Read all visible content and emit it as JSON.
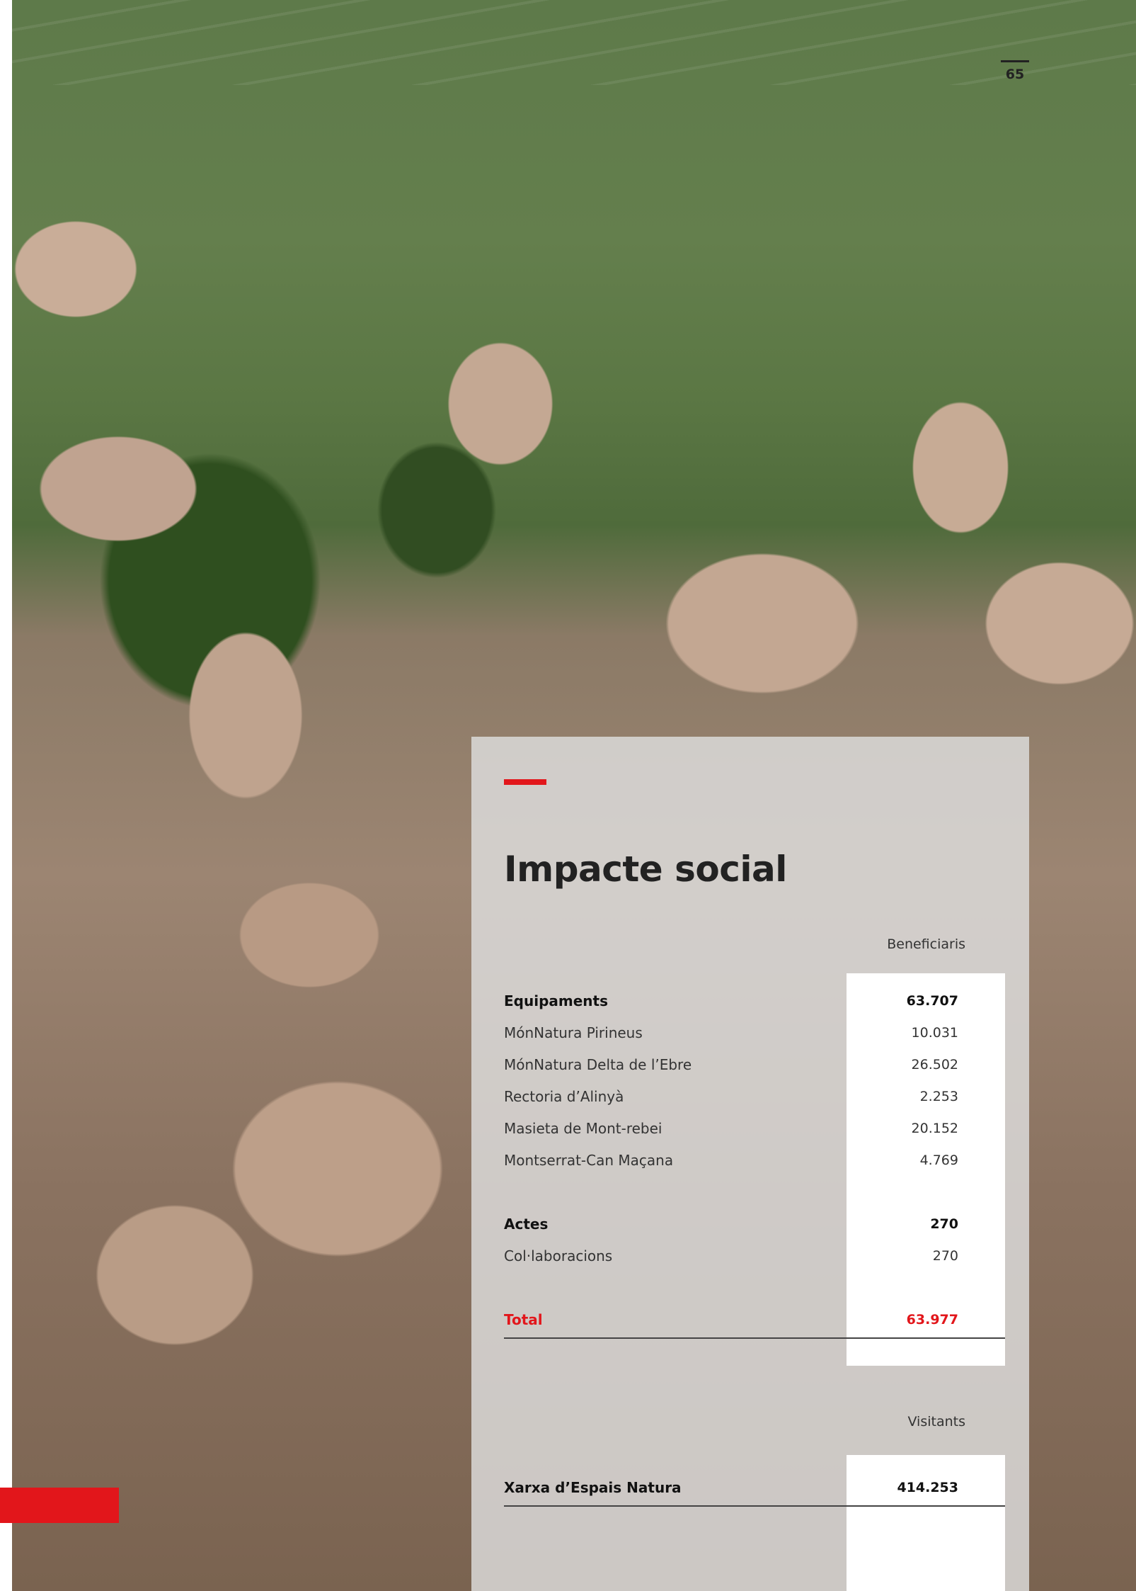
{
  "page": {
    "number": "65"
  },
  "panel": {
    "title": "Impacte social",
    "beneficiaris": {
      "column_header": "Beneficiaris",
      "sections": [
        {
          "label": "Equipaments",
          "value": "63.707",
          "items": [
            {
              "label": "MónNatura Pirineus",
              "value": "10.031"
            },
            {
              "label": "MónNatura Delta de l’Ebre",
              "value": "26.502"
            },
            {
              "label": "Rectoria d’Alinyà",
              "value": "2.253"
            },
            {
              "label": "Masieta de Mont-rebei",
              "value": "20.152"
            },
            {
              "label": "Montserrat-Can Maçana",
              "value": "4.769"
            }
          ]
        },
        {
          "label": "Actes",
          "value": "270",
          "items": [
            {
              "label": "Col·laboracions",
              "value": "270"
            }
          ]
        }
      ],
      "total": {
        "label": "Total",
        "value": "63.977"
      }
    },
    "visitants": {
      "column_header": "Visitants",
      "row": {
        "label": "Xarxa d’Espais Natura",
        "value": "414.253"
      }
    }
  },
  "colors": {
    "accent": "#e2161b",
    "panel_bg": "#dedede",
    "text": "#222222"
  }
}
